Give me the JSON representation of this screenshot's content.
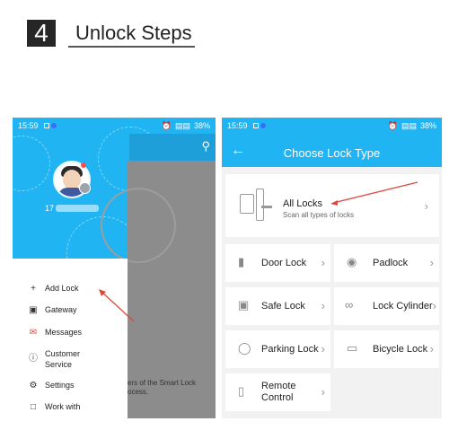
{
  "header": {
    "step_number": "4",
    "title": "Unlock Steps"
  },
  "phone1": {
    "status_time": "15:59",
    "status_battery": "38%",
    "user_id": "17",
    "menu": [
      {
        "label": "Add Lock",
        "icon": "plus-icon"
      },
      {
        "label": "Gateway",
        "icon": "gateway-icon"
      },
      {
        "label": "Messages",
        "icon": "messages-icon"
      },
      {
        "label": "Customer Service",
        "icon": "info-icon"
      },
      {
        "label": "Settings",
        "icon": "settings-icon"
      },
      {
        "label": "Work with",
        "icon": "bookmark-icon"
      }
    ],
    "background_text": "ers of the Smart Lock\nocess."
  },
  "phone2": {
    "status_time": "15:59",
    "status_battery": "38%",
    "title": "Choose Lock Type",
    "all_locks": {
      "label": "All Locks",
      "sub": "Scan all types of locks"
    },
    "lock_types": [
      {
        "label": "Door Lock",
        "icon": "door-lock-icon"
      },
      {
        "label": "Padlock",
        "icon": "padlock-icon"
      },
      {
        "label": "Safe Lock",
        "icon": "safe-lock-icon"
      },
      {
        "label": "Lock Cylinder",
        "icon": "lock-cylinder-icon"
      },
      {
        "label": "Parking Lock",
        "icon": "parking-lock-icon"
      },
      {
        "label": "Bicycle Lock",
        "icon": "bicycle-lock-icon"
      },
      {
        "label": "Remote Control",
        "icon": "remote-control-icon"
      }
    ]
  },
  "colors": {
    "primary": "#21b4f3",
    "arrow": "#e0473a",
    "drawer_overlay": "#8c8c8c"
  }
}
